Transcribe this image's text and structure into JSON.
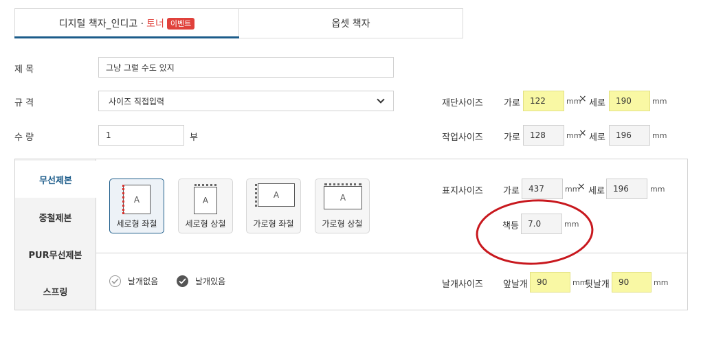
{
  "tabs": {
    "digital_prefix": "디지털 책자_인디고 · ",
    "digital_highlight": "토너",
    "event_badge": "이벤트",
    "offset": "옵셋 책자"
  },
  "form": {
    "title_label": "제 목",
    "title_value": "그냥 그럴 수도 있지",
    "spec_label": "규 격",
    "spec_value": "사이즈 직접입력",
    "qty_label": "수 량",
    "qty_value": "1",
    "qty_unit": "부"
  },
  "cut_size": {
    "label": "재단사이즈",
    "w_label": "가로",
    "w": "122",
    "h_label": "세로",
    "h": "190",
    "unit": "mm",
    "times": "×"
  },
  "work_size": {
    "label": "작업사이즈",
    "w_label": "가로",
    "w": "128",
    "h_label": "세로",
    "h": "196",
    "unit": "mm",
    "times": "×"
  },
  "cover_size": {
    "label": "표지사이즈",
    "w_label": "가로",
    "w": "437",
    "h_label": "세로",
    "h": "196",
    "unit": "mm",
    "times": "×",
    "spine_label": "책등",
    "spine": "7.0"
  },
  "binding": {
    "items": [
      {
        "label": "무선제본"
      },
      {
        "label": "중철제본"
      },
      {
        "label": "PUR무선제본"
      },
      {
        "label": "스프링"
      }
    ],
    "options": [
      {
        "label": "세로형 좌철",
        "glyph": "A"
      },
      {
        "label": "세로형 상철",
        "glyph": "A"
      },
      {
        "label": "가로형 좌철",
        "glyph": "A"
      },
      {
        "label": "가로형 상철",
        "glyph": "A"
      }
    ]
  },
  "wings": {
    "none": "날개없음",
    "yes": "날개있음",
    "size_label": "날개사이즈",
    "front_label": "앞날개",
    "front": "90",
    "back_label": "뒷날개",
    "back": "90",
    "unit": "mm"
  },
  "colors": {
    "accent": "#1c5c8a",
    "event": "#e0413b",
    "highlight": "#f9f8a4",
    "annotation": "#c8181e"
  }
}
